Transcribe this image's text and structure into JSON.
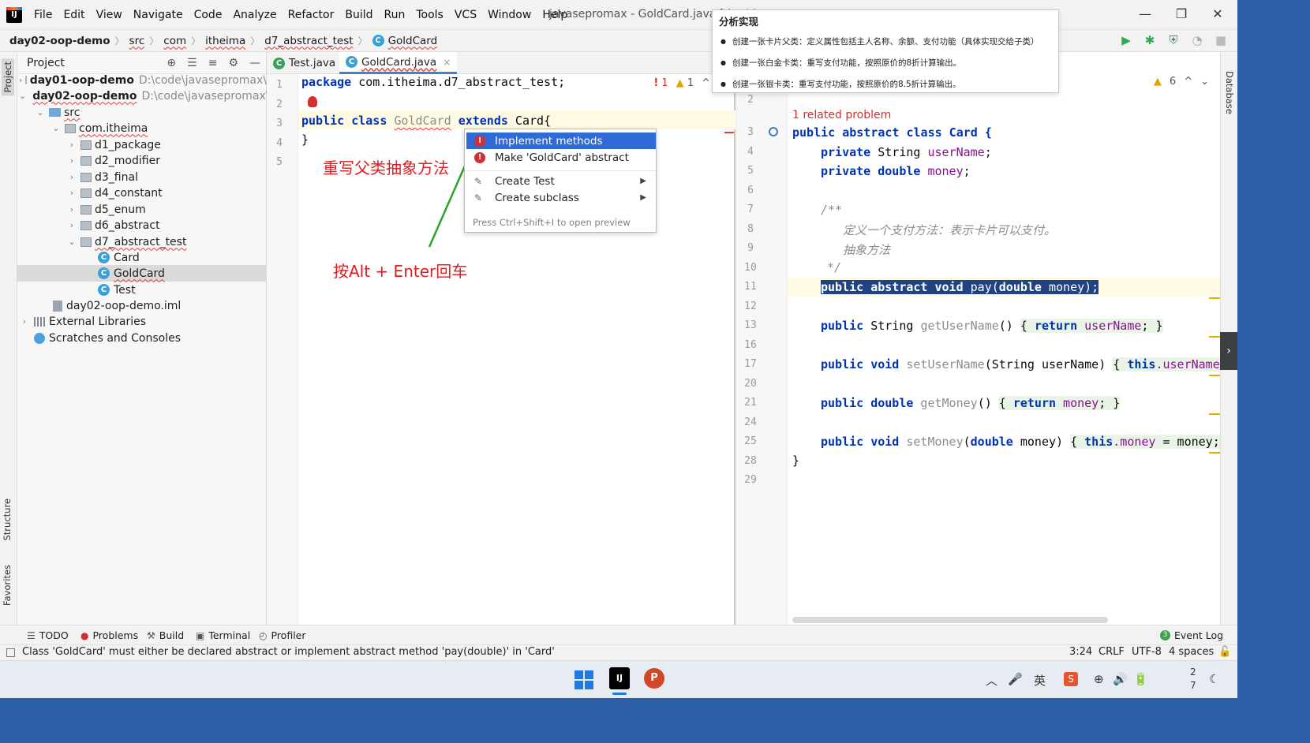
{
  "menubar": {
    "logo": "IJ",
    "items": [
      "File",
      "Edit",
      "View",
      "Navigate",
      "Code",
      "Analyze",
      "Refactor",
      "Build",
      "Run",
      "Tools",
      "VCS",
      "Window",
      "Help"
    ],
    "window_title": "javasepromax - GoldCard.java [day02-oop",
    "minimize": "—",
    "maximize": "❐",
    "close": "✕"
  },
  "breadcrumb": {
    "items": [
      "day02-oop-demo",
      "src",
      "com",
      "itheima",
      "d7_abstract_test"
    ],
    "current": "GoldCard",
    "sep": "〉",
    "class_icon": "C"
  },
  "toolbar": {
    "icons": [
      "run-icon",
      "debug-icon",
      "coverage-icon",
      "profile-icon",
      "stop-icon",
      "search-icon",
      "settings-icon",
      "plugin-icon"
    ],
    "glyphs": [
      "▶",
      "✱",
      "⛨",
      "◔",
      "■",
      "⚲",
      "⚙",
      "◆"
    ]
  },
  "left_strip": {
    "project": "Project",
    "structure": "Structure",
    "favorites": "Favorites"
  },
  "project_panel": {
    "title": "Project",
    "tree": [
      {
        "label": "day01-oop-demo",
        "path": "D:\\code\\javasepromax\\",
        "arrow": "›",
        "bold": true
      },
      {
        "label": "day02-oop-demo",
        "path": "D:\\code\\javasepromax\\",
        "arrow": "⌄",
        "bold": true
      },
      {
        "label": "src",
        "arrow": "⌄"
      },
      {
        "label": "com.itheima",
        "arrow": "⌄"
      },
      {
        "label": "d1_package",
        "arrow": "›"
      },
      {
        "label": "d2_modifier",
        "arrow": "›"
      },
      {
        "label": "d3_final",
        "arrow": "›"
      },
      {
        "label": "d4_constant",
        "arrow": "›"
      },
      {
        "label": "d5_enum",
        "arrow": "›"
      },
      {
        "label": "d6_abstract",
        "arrow": "›"
      },
      {
        "label": "d7_abstract_test",
        "arrow": "⌄"
      },
      {
        "label": "Card"
      },
      {
        "label": "GoldCard"
      },
      {
        "label": "Test"
      },
      {
        "label": "day02-oop-demo.iml"
      },
      {
        "label": "External Libraries",
        "arrow": "›"
      },
      {
        "label": "Scratches and Consoles"
      }
    ]
  },
  "editor_left": {
    "tabs": [
      {
        "label": "Test.java",
        "close": "×"
      },
      {
        "label": "GoldCard.java",
        "close": "×"
      }
    ],
    "line_numbers": [
      "1",
      "2",
      "3",
      "4",
      "5"
    ],
    "code": {
      "line1_kw": "package",
      "line1_rest": " com.itheima.d7_abstract_test;",
      "line3_kw1": "public",
      "line3_kw2": "class",
      "line3_cls": "GoldCard",
      "line3_kw3": "extends",
      "line3_rest": " Card{",
      "line4": "}"
    },
    "badges": {
      "errors": "1",
      "warnings": "1",
      "err_icon": "!",
      "warn_icon": "▲",
      "up": "^"
    }
  },
  "annotations": {
    "override": "重写父类抽象方法",
    "shortcut": "按Alt + Enter回车"
  },
  "popup": {
    "items": [
      {
        "label": "Implement methods",
        "icon": "!"
      },
      {
        "label": "Make 'GoldCard' abstract",
        "icon": "!"
      },
      {
        "label": "Create Test",
        "icon": "✎",
        "submenu": "▶"
      },
      {
        "label": "Create subclass",
        "icon": "✎",
        "submenu": "▶"
      }
    ],
    "hint": "Press Ctrl+Shift+I to open preview"
  },
  "editor_right": {
    "badge": "6",
    "badge_icon": "▲",
    "up": "^",
    "down": "⌄",
    "related": "1 related problem",
    "line_numbers": [
      "2",
      "3",
      "4",
      "5",
      "6",
      "7",
      "8",
      "9",
      "10",
      "11",
      "12",
      "13",
      "16",
      "17",
      "20",
      "21",
      "24",
      "25",
      "28",
      "29"
    ],
    "code": {
      "l3": "public abstract class Card {",
      "l4a": "private",
      "l4b": " String ",
      "l4c": "userName",
      "l4d": ";",
      "l5a": "private double",
      "l5c": "money",
      "l5d": ";",
      "l7": "/**",
      "l8": "定义一个支付方法：表示卡片可以支付。",
      "l9": "抽象方法",
      "l10": "*/",
      "l11a": "public abstract void",
      "l11b": " pay(",
      "l11c": "double",
      "l11d": " money);",
      "l13a": "public",
      "l13b": " String ",
      "l13c": "getUserName",
      "l13d": "() ",
      "l13e": "{ ",
      "l13f": "return",
      "l13g": " userName",
      "l13h": "; }",
      "l17a": "public void",
      "l17b": " setUserName",
      "l17c": "(String userName) ",
      "l17d": "{ ",
      "l17e": "this",
      "l17f": ".userName",
      "l21a": "public double",
      "l21b": " getMoney",
      "l21c": "() ",
      "l21d": "{ ",
      "l21e": "return",
      "l21f": " money",
      "l21g": "; }",
      "l25a": "public void",
      "l25b": " setMoney",
      "l25c": "(",
      "l25d": "double",
      "l25e": " money) ",
      "l25f": "{ ",
      "l25g": "this",
      "l25h": ".money",
      "l25i": " = money;",
      "l28": "}"
    }
  },
  "right_strip": {
    "database": "Database",
    "expand": "›"
  },
  "analysis": {
    "title": "分析实现",
    "items": [
      "创建一张卡片父类：定义属性包括主人名称、余额、支付功能（具体实现交给子类）",
      "创建一张白金卡类：重写支付功能，按照原价的8折计算输出。",
      "创建一张银卡类：重写支付功能，按照原价的8.5折计算输出。"
    ]
  },
  "bottom_tabs": [
    {
      "label": "TODO",
      "icon": "☰"
    },
    {
      "label": "Problems",
      "icon": "●"
    },
    {
      "label": "Build",
      "icon": "⚒"
    },
    {
      "label": "Terminal",
      "icon": "▣"
    },
    {
      "label": "Profiler",
      "icon": "◴"
    }
  ],
  "event_log": "Event Log",
  "event_log_count": "3",
  "status": {
    "message": "Class 'GoldCard' must either be declared abstract or implement abstract method 'pay(double)' in 'Card'",
    "position": "3:24",
    "line_sep": "CRLF",
    "encoding": "UTF-8",
    "indent": "4 spaces"
  },
  "taskbar": {
    "idea": "IJ",
    "ppt": "P",
    "tray_glyphs": [
      "︿",
      "🎤",
      "英",
      "S",
      "⊕",
      "🔊",
      "🔋"
    ],
    "clock_line1": "2",
    "clock_line2": "7",
    "moon": "☾"
  },
  "colors": {
    "accent": "#2e6bd6",
    "error": "#d32f2f",
    "annotation": "#e11d22",
    "keyword": "#0033b3",
    "field": "#871094"
  }
}
